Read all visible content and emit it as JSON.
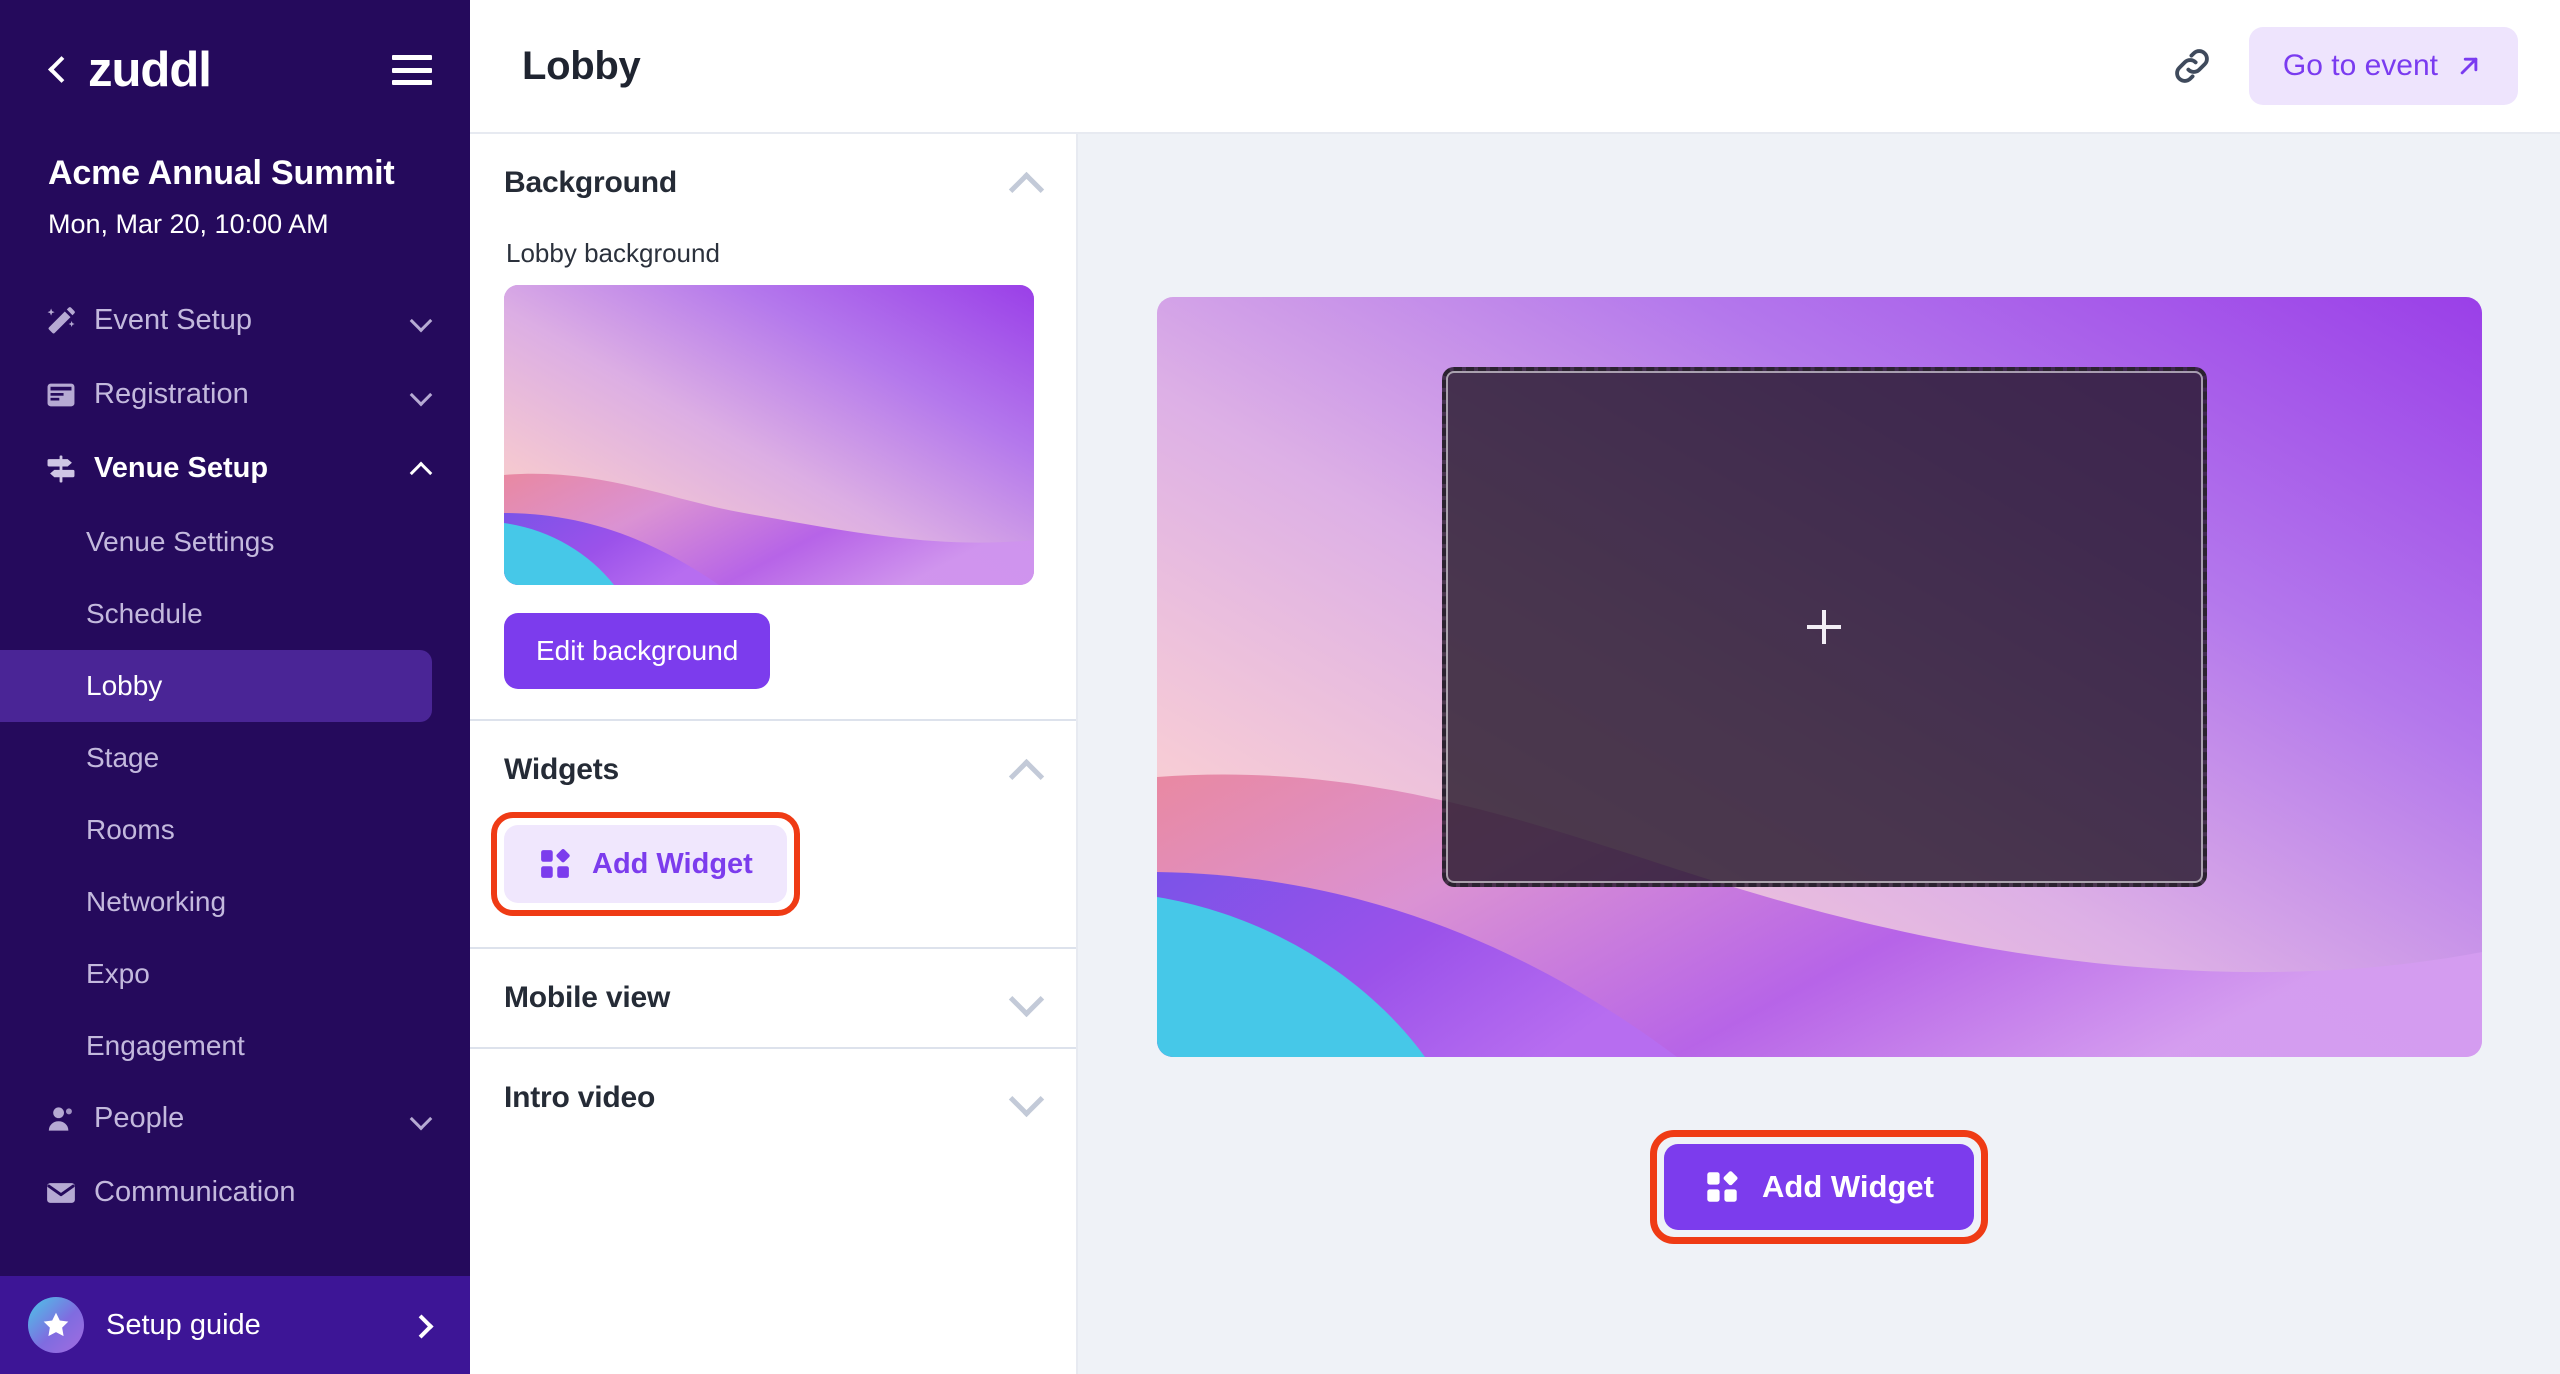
{
  "colors": {
    "sidebar_bg": "#250a5c",
    "sidebar_active": "#4a2596",
    "sidebar_footer": "#3d1596",
    "accent_purple": "#7c3ced",
    "accent_soft": "#f0e7fd",
    "goto_bg": "#eee4fd",
    "highlight_ring": "#ef3b15",
    "canvas_bg": "#eff2f7",
    "panel_border": "#dde2ec"
  },
  "sidebar": {
    "back_icon": "chevron-left-icon",
    "logo": "zuddl",
    "menu_icon": "hamburger-menu-icon",
    "event_name": "Acme Annual Summit",
    "event_datetime": "Mon, Mar 20, 10:00 AM",
    "nav": [
      {
        "label": "Event Setup",
        "icon": "magic-wand-icon",
        "expanded": false,
        "chevron": "chevron-down-icon"
      },
      {
        "label": "Registration",
        "icon": "form-card-icon",
        "expanded": false,
        "chevron": "chevron-down-icon"
      },
      {
        "label": "Venue Setup",
        "icon": "signpost-icon",
        "expanded": true,
        "chevron": "chevron-up-icon"
      }
    ],
    "venue_subnav": [
      {
        "label": "Venue Settings",
        "active": false
      },
      {
        "label": "Schedule",
        "active": false
      },
      {
        "label": "Lobby",
        "active": true
      },
      {
        "label": "Stage",
        "active": false
      },
      {
        "label": "Rooms",
        "active": false
      },
      {
        "label": "Networking",
        "active": false
      },
      {
        "label": "Expo",
        "active": false
      },
      {
        "label": "Engagement",
        "active": false
      }
    ],
    "nav_lower": [
      {
        "label": "People",
        "icon": "person-icon",
        "expanded": false,
        "chevron": "chevron-down-icon"
      },
      {
        "label": "Communication",
        "icon": "envelope-icon",
        "expanded": false,
        "chevron": ""
      }
    ],
    "footer": {
      "label": "Setup guide",
      "icon": "star-badge-icon",
      "chevron": "chevron-right-icon"
    }
  },
  "topbar": {
    "title": "Lobby",
    "link_icon": "link-chain-icon",
    "go_to_event_label": "Go to event",
    "go_to_event_icon": "arrow-up-right-icon"
  },
  "panel": {
    "sections": [
      {
        "title": "Background",
        "chevron": "chevron-up-icon",
        "field_label": "Lobby background",
        "thumbnail_alt": "lobby-background-preview",
        "edit_button": "Edit background"
      },
      {
        "title": "Widgets",
        "chevron": "chevron-up-icon",
        "add_widget_label": "Add Widget",
        "add_widget_icon": "widget-grid-icon",
        "highlighted": true
      },
      {
        "title": "Mobile view",
        "chevron": "chevron-down-icon"
      },
      {
        "title": "Intro video",
        "chevron": "chevron-down-icon"
      }
    ]
  },
  "canvas": {
    "dropzone": {
      "icon": "plus-icon",
      "state": "empty-widget-drop-area"
    },
    "add_widget_label": "Add Widget",
    "add_widget_icon": "widget-grid-icon",
    "highlighted": true
  }
}
